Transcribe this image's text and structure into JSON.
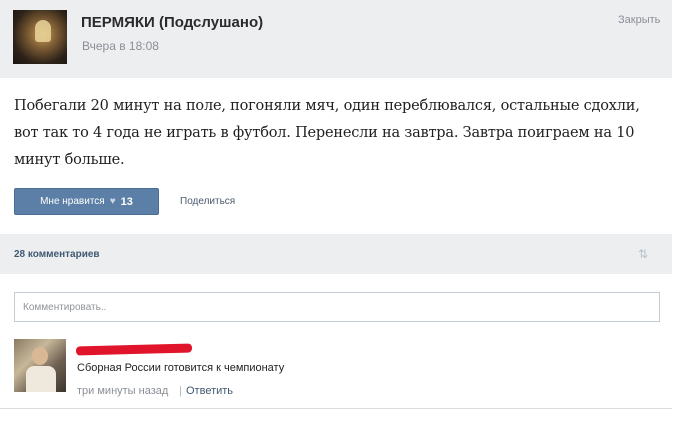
{
  "post": {
    "group_name": "ПЕРМЯКИ (Подслушано)",
    "date": "Вчера в 18:08",
    "close_label": "Закрыть",
    "text": "Побегали 20 минут на поле, погоняли мяч, один переблювался, остальные сдохли, вот так то 4 года не играть в футбол. Перенесли на завтра. Завтра поиграем на 10 минут больше.",
    "like_label": "Мне нравится",
    "like_count": "13",
    "share_label": "Поделиться"
  },
  "comments": {
    "count_label": "28 комментариев",
    "input_placeholder": "Комментировать..",
    "items": [
      {
        "text": "Сборная России готовится к чемпионату",
        "time": "три минуты назад",
        "separator": "|",
        "reply_label": "Ответить"
      }
    ]
  },
  "icons": {
    "like": "heart-icon",
    "sort": "sort-arrows-icon"
  },
  "colors": {
    "like_button": "#5b7fa6",
    "link": "#3f5872",
    "redaction": "#e0142a"
  }
}
